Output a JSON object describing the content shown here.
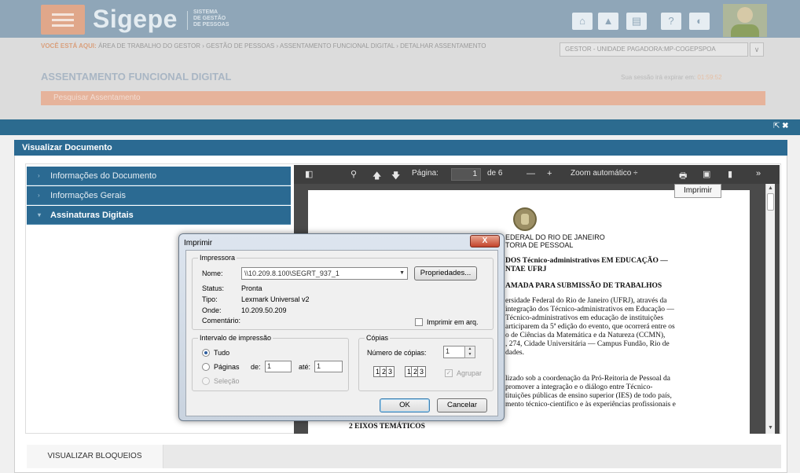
{
  "header": {
    "logo": "Sigepe",
    "logo_sub": [
      "SISTEMA",
      "DE GESTÃO",
      "DE PESSOAS"
    ],
    "icons": [
      "home-icon",
      "bell-icon",
      "book-icon",
      "help-icon",
      "contrast-icon"
    ]
  },
  "breadcrumb": {
    "prefix": "VOCÊ ESTÁ AQUI:",
    "path": "ÁREA DE TRABALHO DO GESTOR › GESTÃO DE PESSOAS › ASSENTAMENTO FUNCIONAL DIGITAL › DETALHAR ASSENTAMENTO"
  },
  "role_select": "GESTOR - UNIDADE PAGADORA:MP-COGEPSPOA",
  "page": {
    "title": "ASSENTAMENTO FUNCIONAL DIGITAL",
    "session_label": "Sua sessão irá expirar em:",
    "session_time": "01:59:52",
    "search_tab": "Pesquisar Assentamento"
  },
  "modal": {
    "title": "Visualizar Documento",
    "accordion": [
      {
        "label": "Informações do Documento",
        "expanded": false
      },
      {
        "label": "Informações Gerais",
        "expanded": false
      },
      {
        "label": "Assinaturas Digitais",
        "expanded": true
      }
    ],
    "bottom_button": "VISUALIZAR BLOQUEIOS"
  },
  "pdf": {
    "page_label": "Página:",
    "page_current": "1",
    "page_total": "de 6",
    "zoom": "Zoom automático",
    "print_tooltip": "Imprimir",
    "lines": [
      "EDERAL DO RIO DE JANEIRO",
      "TORIA DE PESSOAL",
      "DOS Técnico-administrativos EM EDUCAÇÃO —",
      "NTAE UFRJ",
      "AMADA PARA SUBMISSÃO DE TRABALHOS",
      "ersidade Federal do Rio de Janeiro (UFRJ), através da",
      "integração dos Técnico-administrativos em Educação —",
      "Técnico-administrativos em educação de instituições",
      "articiparem da 5ª edição do evento, que ocorrerá entre os",
      "o de Ciências da Matemática e da Natureza (CCMN),",
      ", 274, Cidade Universitária — Campus Fundão, Rio de",
      "dades.",
      "lizado sob a coordenação da Pró-Reitoria de Pessoal da",
      "promover a integração e o diálogo entre Técnico-",
      "tituições públicas de ensino superior (IES) de todo país,",
      "mento técnico-científico e às experiências profissionais e",
      "2 EIXOS TEMÁTICOS"
    ]
  },
  "print_dialog": {
    "title": "Imprimir",
    "close": "X",
    "printer_group": "Impressora",
    "name_label": "Nome:",
    "name_value": "\\\\10.209.8.100\\SEGRT_937_1",
    "properties_button": "Propriedades...",
    "status_label": "Status:",
    "status_value": "Pronta",
    "type_label": "Tipo:",
    "type_value": "Lexmark Universal v2",
    "where_label": "Onde:",
    "where_value": "10.209.50.209",
    "comment_label": "Comentário:",
    "print_to_file": "Imprimir em arq.",
    "range_group": "Intervalo de impressão",
    "range_all": "Tudo",
    "range_pages": "Páginas",
    "from_label": "de:",
    "from_value": "1",
    "to_label": "até:",
    "to_value": "1",
    "range_selection": "Seleção",
    "copies_group": "Cópias",
    "copies_label": "Número de cópias:",
    "copies_value": "1",
    "collate_label": "Agrupar",
    "ok_button": "OK",
    "cancel_button": "Cancelar"
  }
}
